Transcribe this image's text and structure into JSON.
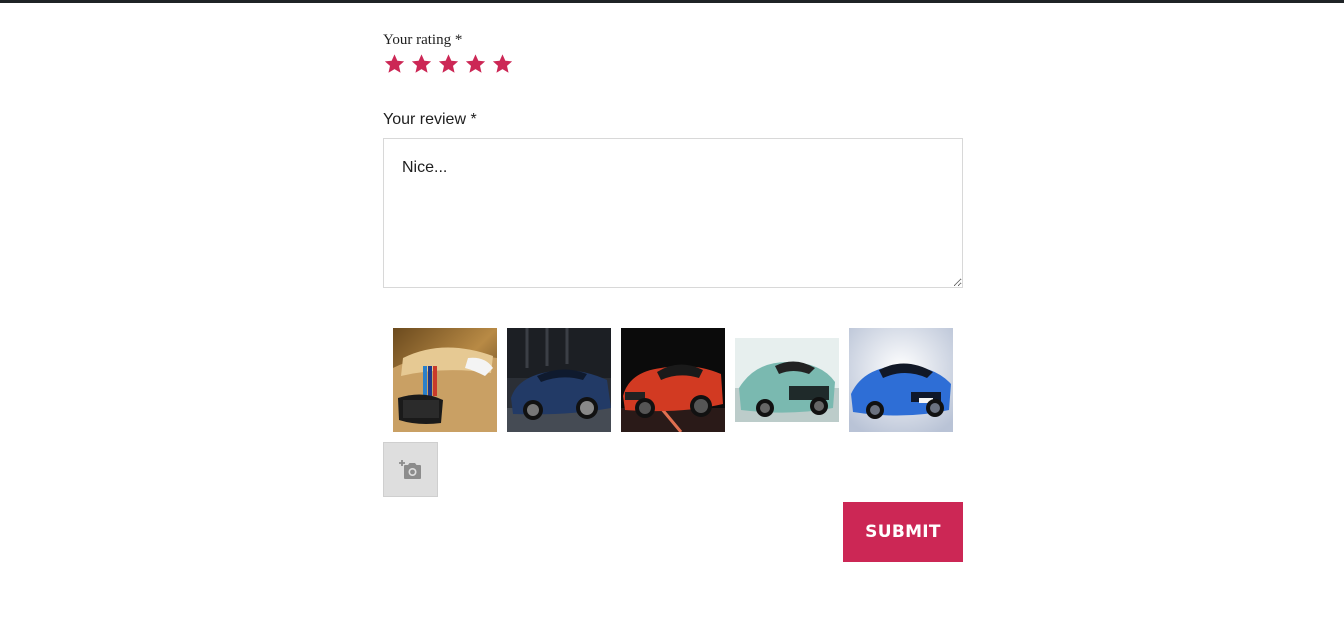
{
  "form": {
    "rating_label": "Your rating *",
    "rating": {
      "value": 5,
      "max": 5
    },
    "review_label": "Your review *",
    "review_value": "Nice...",
    "images": [
      {
        "alt": "gold car"
      },
      {
        "alt": "dark blue car"
      },
      {
        "alt": "red car"
      },
      {
        "alt": "teal convertible"
      },
      {
        "alt": "blue sports car"
      }
    ],
    "add_photo_icon": "camera-plus-icon",
    "submit_label": "Submit"
  },
  "colors": {
    "accent": "#cc2755",
    "top_bar": "#1f2326",
    "border": "#d8d8d8",
    "add_photo_bg": "#dedede"
  }
}
